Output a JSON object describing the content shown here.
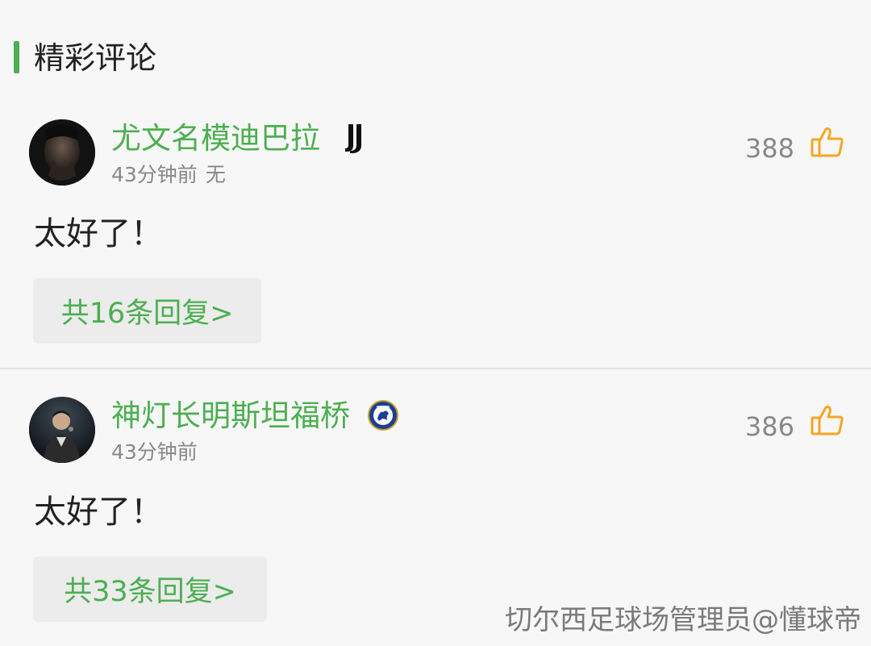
{
  "colors": {
    "accent": "#4caf50",
    "username": "#4caf50",
    "like_icon": "#f5a623"
  },
  "section": {
    "title": "精彩评论"
  },
  "comments": [
    {
      "username": "尤文名模迪巴拉",
      "team_icon": "juventus-logo-icon",
      "time": "43分钟前",
      "extra": "无",
      "likes": "388",
      "text": "太好了！",
      "replies_label": "共16条回复>"
    },
    {
      "username": "神灯长明斯坦福桥",
      "team_icon": "chelsea-logo-icon",
      "time": "43分钟前",
      "extra": "",
      "likes": "386",
      "text": "太好了！",
      "replies_label": "共33条回复>"
    }
  ],
  "watermark": "切尔西足球场管理员@懂球帝"
}
